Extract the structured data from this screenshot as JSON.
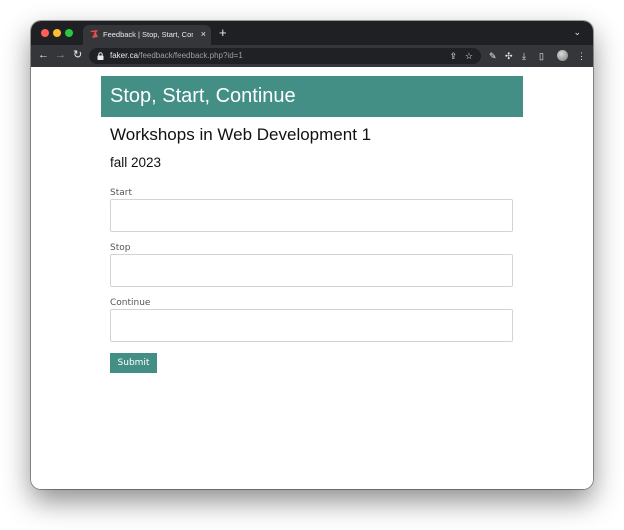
{
  "browser": {
    "tab": {
      "title": "Feedback | Stop, Start, Continue",
      "close_glyph": "×",
      "favicon": "faker-favicon-icon"
    },
    "new_tab_glyph": "+",
    "tab_menu_glyph": "⌄",
    "nav": {
      "back_glyph": "←",
      "forward_glyph": "→",
      "reload_glyph": "↻"
    },
    "url": {
      "host": "faker.ca",
      "path": "/feedback/feedback.php?id=1"
    },
    "icons": {
      "share": "⇪",
      "star": "☆",
      "extension_1": "✎",
      "extensions": "✣",
      "download": "⤓",
      "sidebar": "▯",
      "menu": "⋮"
    }
  },
  "page": {
    "banner_title": "Stop, Start, Continue",
    "course_title": "Workshops in Web Development 1",
    "term": "fall 2023",
    "fields": [
      {
        "label": "Start",
        "value": ""
      },
      {
        "label": "Stop",
        "value": ""
      },
      {
        "label": "Continue",
        "value": ""
      }
    ],
    "submit_label": "Submit"
  },
  "colors": {
    "accent": "#438f85",
    "chrome_dark": "#1f2023",
    "chrome_toolbar": "#35363a"
  }
}
